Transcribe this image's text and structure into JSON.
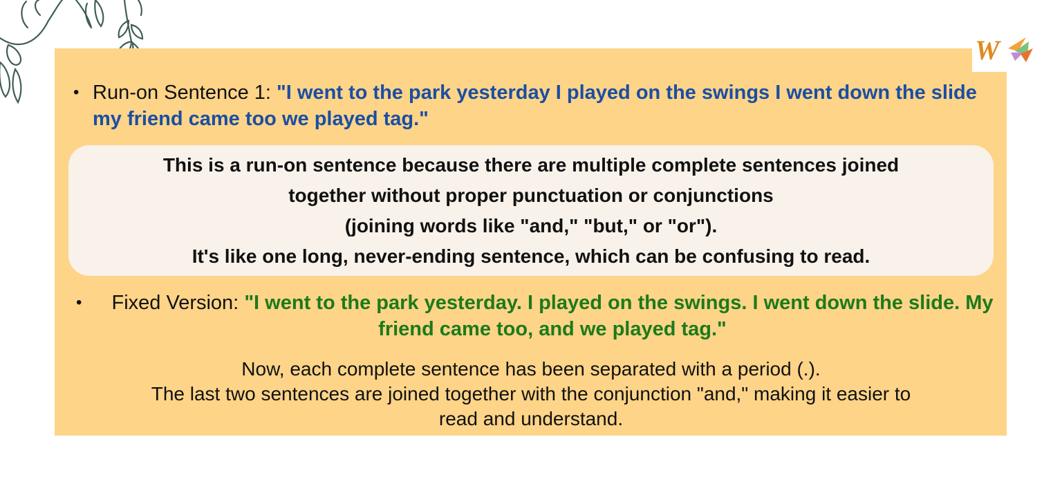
{
  "branding": {
    "logo_text": "W",
    "brand_color": "#e08a1e"
  },
  "colors": {
    "panel": "#fdd488",
    "box": "#f8f2ea",
    "blue_quote": "#1b4ea3",
    "green_quote": "#1d7a1a"
  },
  "example": {
    "bullet": "•",
    "label": "Run-on Sentence 1: ",
    "quote": "\"I went to the park yesterday I played on the swings I went down the slide my friend came too we played tag.\""
  },
  "explanation": {
    "lines": [
      "This is a run-on sentence because there are multiple complete sentences joined",
      "together without proper punctuation or conjunctions",
      "(joining words like \"and,\" \"but,\" or \"or\").",
      "It's like one long, never-ending sentence, which can be confusing to read."
    ]
  },
  "fixed": {
    "bullet": "•",
    "label": "Fixed Version: ",
    "quote": "\"I went to the park yesterday. I played on the swings. I went down the slide. My friend came too, and we played tag.\""
  },
  "summary": {
    "lines": [
      "Now, each complete sentence has been separated with a period (.).",
      "The last two sentences are joined together with the conjunction \"and,\" making it easier to",
      "read and understand."
    ]
  }
}
